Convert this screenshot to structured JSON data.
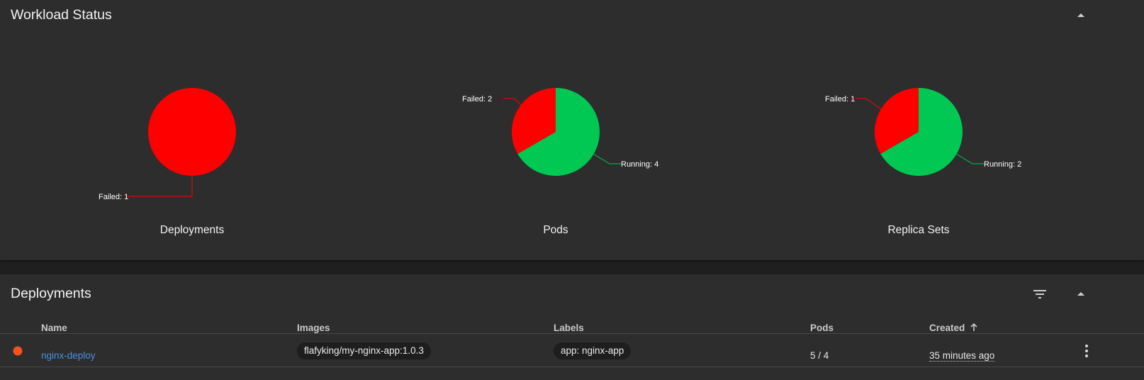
{
  "workload_status": {
    "title": "Workload Status",
    "charts": [
      {
        "id": "deployments",
        "title": "Deployments",
        "slices": [
          {
            "label": "Failed",
            "value": 1,
            "color": "#ff0000"
          }
        ]
      },
      {
        "id": "pods",
        "title": "Pods",
        "slices": [
          {
            "label": "Failed",
            "value": 2,
            "color": "#ff0000"
          },
          {
            "label": "Running",
            "value": 4,
            "color": "#00c853"
          }
        ]
      },
      {
        "id": "replica_sets",
        "title": "Replica Sets",
        "slices": [
          {
            "label": "Failed",
            "value": 1,
            "color": "#ff0000"
          },
          {
            "label": "Running",
            "value": 2,
            "color": "#00c853"
          }
        ]
      }
    ]
  },
  "deployments": {
    "title": "Deployments",
    "columns": {
      "name": "Name",
      "images": "Images",
      "labels": "Labels",
      "pods": "Pods",
      "created": "Created"
    },
    "rows": [
      {
        "status_color": "#f4511e",
        "name": "nginx-deploy",
        "image": "flafyking/my-nginx-app:1.0.3",
        "label": "app: nginx-app",
        "pods": "5 / 4",
        "created": "35 minutes ago"
      }
    ]
  },
  "icons": {
    "collapse": "chevron-up-icon",
    "filter": "filter-icon",
    "sort": "arrow-up-icon",
    "menu": "more-vert-icon",
    "status": "status-dot-icon"
  }
}
